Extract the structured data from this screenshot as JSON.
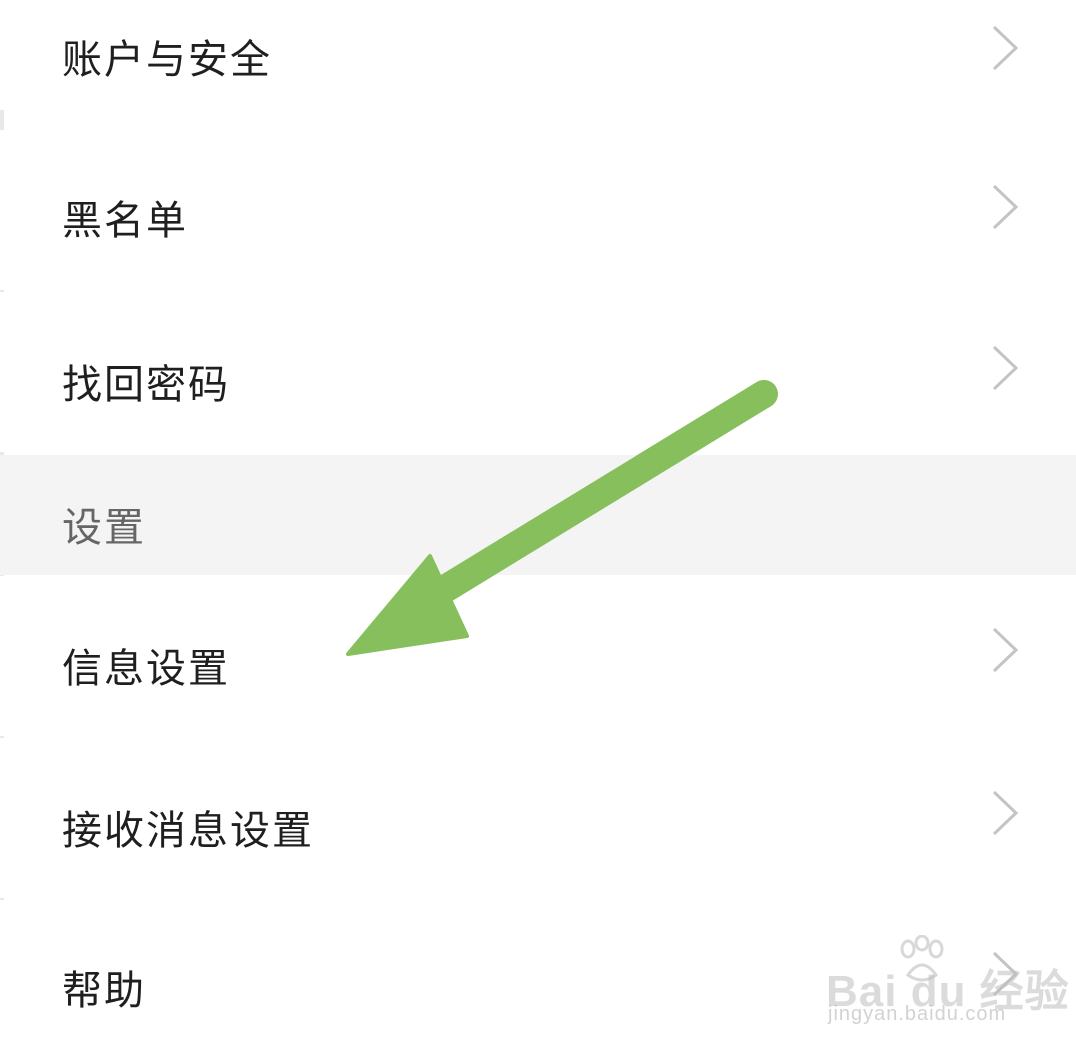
{
  "menu": {
    "items_top": [
      {
        "label": "账户与安全"
      },
      {
        "label": "黑名单"
      },
      {
        "label": "找回密码"
      }
    ],
    "section_header": "设置",
    "items_bottom": [
      {
        "label": "信息设置"
      },
      {
        "label": "接收消息设置"
      },
      {
        "label": "帮助"
      }
    ]
  },
  "annotation": {
    "arrow_color": "#86bf5c"
  },
  "watermark": {
    "brand": "Bai du 经验",
    "url": "jingyan.baidu.com"
  },
  "icons": {
    "row_chevron": "chevron-right-icon",
    "watermark_logo": "paw-icon"
  }
}
